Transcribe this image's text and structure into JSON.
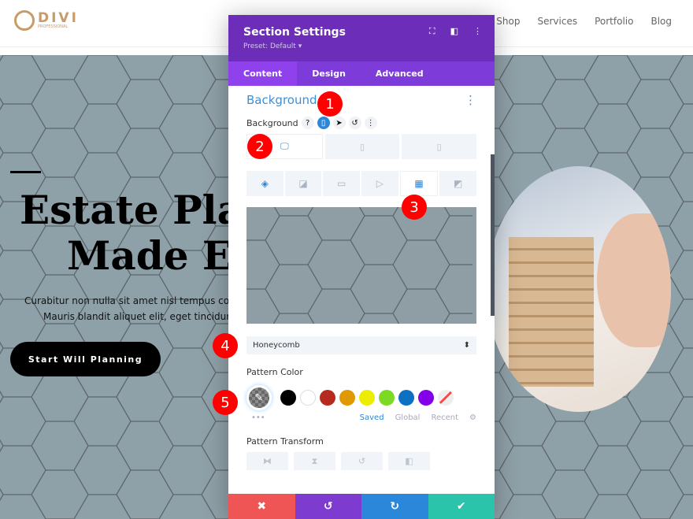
{
  "site": {
    "logo_text": "DIVI",
    "logo_sub": "PROFESSIONAL",
    "nav": [
      "Shop",
      "Services",
      "Portfolio",
      "Blog"
    ]
  },
  "hero": {
    "title_line1": "Estate Plan",
    "title_line2": "Made Eas",
    "para_line1": "Curabitur non nulla sit amet nisl tempus conv",
    "para_line2": "Mauris blandit aliquet elit, eget tincidunt",
    "cta": "Start Will Planning"
  },
  "modal": {
    "title": "Section Settings",
    "preset": "Preset: Default ▾",
    "tabs": [
      "Content",
      "Design",
      "Advanced"
    ],
    "active_tab": "Content",
    "section_title": "Background",
    "bg_label": "Background",
    "help": "?",
    "pattern_select": "Honeycomb",
    "pattern_color_label": "Pattern Color",
    "swatch_colors": [
      "#000000",
      "#ffffff",
      "#b72a1e",
      "#e09900",
      "#eded00",
      "#7cda24",
      "#0c71c3",
      "#8300e9"
    ],
    "palette_tabs": {
      "saved": "Saved",
      "global": "Global",
      "recent": "Recent"
    },
    "more": "•••",
    "transform_label": "Pattern Transform",
    "footer_colors": {
      "cancel": "#ef5555",
      "undo": "#7e3bd0",
      "redo": "#2b87da",
      "save": "#29c4a9"
    }
  },
  "badges": [
    "1",
    "2",
    "3",
    "4",
    "5"
  ],
  "colors": {
    "header": "#6c2eb9",
    "tabs": "#7d3bd9",
    "accent": "#2b87da",
    "hero_bg": "#8fa1a8"
  }
}
